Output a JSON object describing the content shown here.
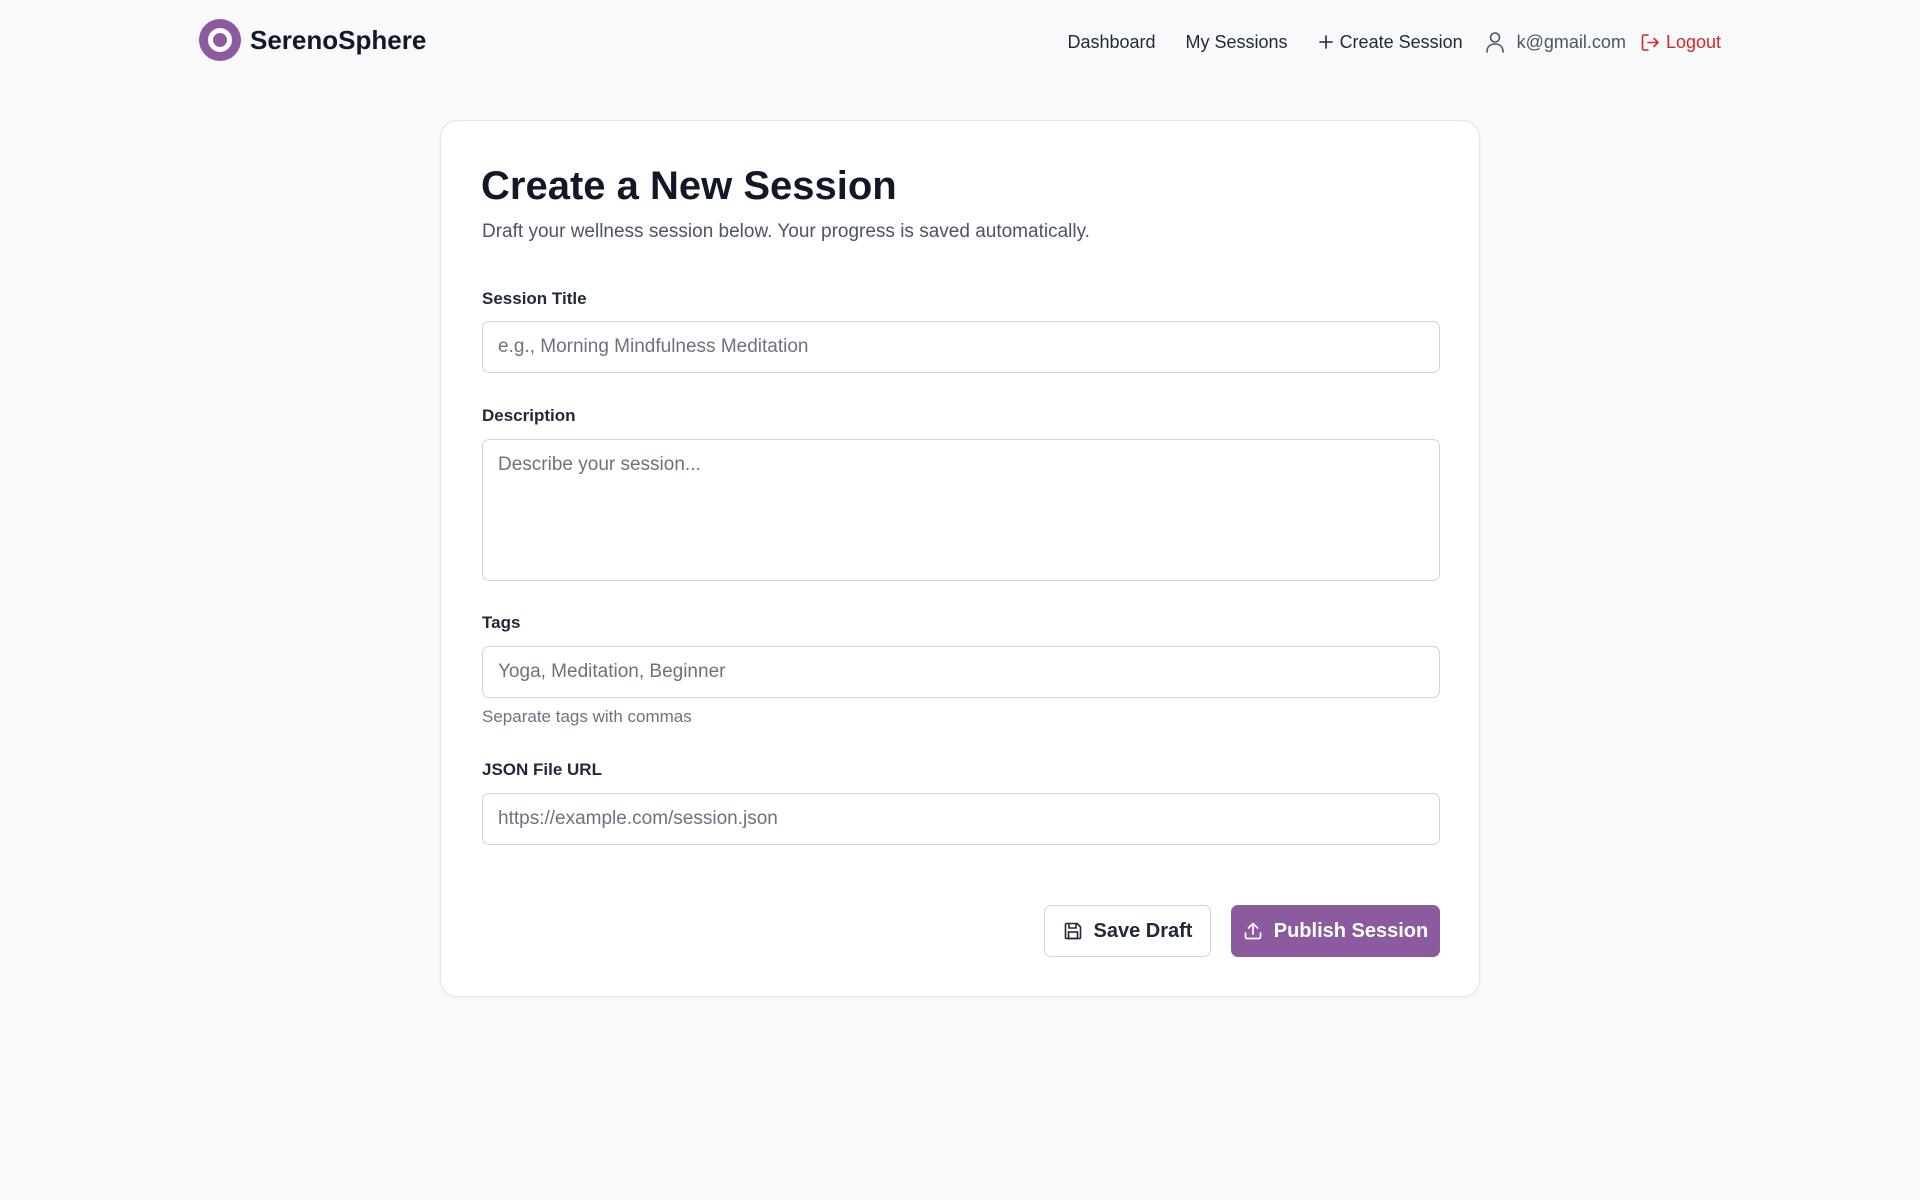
{
  "brand": {
    "name": "SerenoSphere",
    "accent_color": "#8b5a9f"
  },
  "nav": {
    "dashboard": "Dashboard",
    "my_sessions": "My Sessions",
    "create_session": "Create Session",
    "user_email": "k@gmail.com",
    "logout": "Logout",
    "logout_color": "#dc2626"
  },
  "form": {
    "title": "Create a New Session",
    "subtitle": "Draft your wellness session below. Your progress is saved automatically.",
    "session_title": {
      "label": "Session Title",
      "placeholder": "e.g., Morning Mindfulness Meditation",
      "value": ""
    },
    "description": {
      "label": "Description",
      "placeholder": "Describe your session...",
      "value": ""
    },
    "tags": {
      "label": "Tags",
      "placeholder": "Yoga, Meditation, Beginner",
      "value": "",
      "help": "Separate tags with commas"
    },
    "json_url": {
      "label": "JSON File URL",
      "placeholder": "https://example.com/session.json",
      "value": ""
    },
    "save_draft": "Save Draft",
    "publish": "Publish Session"
  },
  "icons": {
    "logo": "ring-logo-icon",
    "create": "plus-icon",
    "user": "user-icon",
    "logout": "logout-icon",
    "save": "floppy-disk-icon",
    "publish": "upload-icon"
  }
}
